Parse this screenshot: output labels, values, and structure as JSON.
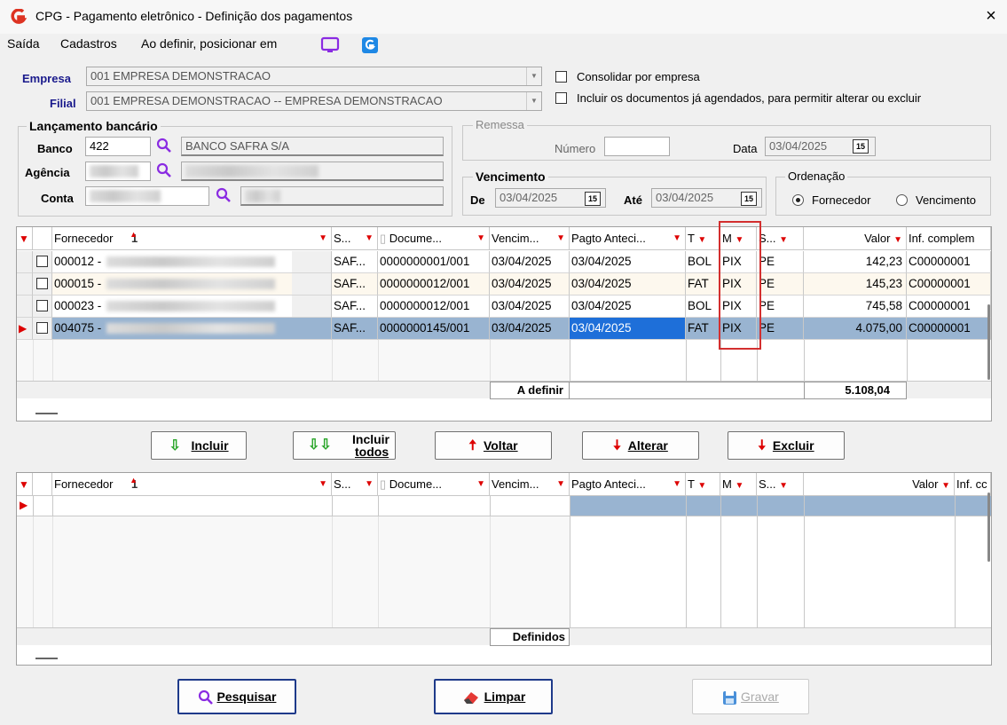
{
  "window": {
    "title": "CPG - Pagamento eletrônico - Definição dos pagamentos",
    "close": "×"
  },
  "menu": {
    "saida": "Saída",
    "cadastros": "Cadastros",
    "ao_definir": "Ao definir, posicionar em"
  },
  "empresa": {
    "label": "Empresa",
    "value": "001 EMPRESA DEMONSTRACAO"
  },
  "filial": {
    "label": "Filial",
    "value": "001 EMPRESA DEMONSTRACAO -- EMPRESA DEMONSTRACAO"
  },
  "options": {
    "consolidar": "Consolidar por empresa",
    "incluir_agendados": "Incluir os documentos já agendados, para permitir alterar ou excluir"
  },
  "lancamento": {
    "title": "Lançamento bancário",
    "banco_label": "Banco",
    "banco_value": "422",
    "banco_name": "BANCO SAFRA S/A",
    "agencia_label": "Agência",
    "conta_label": "Conta"
  },
  "remessa": {
    "title": "Remessa",
    "numero_label": "Número",
    "numero_value": "",
    "data_label": "Data",
    "data_value": "03/04/2025"
  },
  "vencimento": {
    "title": "Vencimento",
    "de_label": "De",
    "de_value": "03/04/2025",
    "ate_label": "Até",
    "ate_value": "03/04/2025"
  },
  "ordenacao": {
    "title": "Ordenação",
    "fornecedor": "Fornecedor",
    "vencimento": "Vencimento",
    "selected": "Fornecedor"
  },
  "cal_icon": "15",
  "grid_headers": {
    "fornecedor": "Fornecedor",
    "sort_num": "1",
    "s": "S...",
    "documento": "Docume...",
    "vencimento": "Vencim...",
    "pagto": "Pagto Anteci...",
    "t": "T",
    "m": "M",
    "s2": "S...",
    "valor": "Valor",
    "inf": "Inf. complem"
  },
  "grid2_headers": {
    "inf": "Inf. cc"
  },
  "top_rows": [
    {
      "fornecedor": "000012 -",
      "s": "SAF...",
      "documento": "0000000001/001",
      "vencimento": "03/04/2025",
      "pagto": "03/04/2025",
      "t": "BOL",
      "m": "PIX",
      "s2": "PE",
      "valor": "142,23",
      "inf": "C00000001"
    },
    {
      "fornecedor": "000015 -",
      "s": "SAF...",
      "documento": "0000000012/001",
      "vencimento": "03/04/2025",
      "pagto": "03/04/2025",
      "t": "FAT",
      "m": "PIX",
      "s2": "PE",
      "valor": "145,23",
      "inf": "C00000001"
    },
    {
      "fornecedor": "000023 -",
      "s": "SAF...",
      "documento": "0000000012/001",
      "vencimento": "03/04/2025",
      "pagto": "03/04/2025",
      "t": "BOL",
      "m": "PIX",
      "s2": "PE",
      "valor": "745,58",
      "inf": "C00000001"
    },
    {
      "fornecedor": "004075 -",
      "s": "SAF...",
      "documento": "0000000145/001",
      "vencimento": "03/04/2025",
      "pagto": "03/04/2025",
      "t": "FAT",
      "m": "PIX",
      "s2": "PE",
      "valor": "4.075,00",
      "inf": "C00000001"
    }
  ],
  "totals_top": {
    "label": "A definir",
    "value": "5.108,04"
  },
  "totals_bottom": {
    "label": "Definidos"
  },
  "actions": {
    "incluir": "Incluir",
    "incluir_todos_1": "Incluir",
    "incluir_todos_2": "todos",
    "voltar": "Voltar",
    "alterar": "Alterar",
    "excluir": "Excluir"
  },
  "footer": {
    "pesquisar": "Pesquisar",
    "limpar": "Limpar",
    "gravar": "Gravar"
  },
  "colors": {
    "selected_row": "#99b4d1",
    "selected_cell": "#1e6fd9",
    "highlight_border": "#d32f2f",
    "filter_red": "#dd0000"
  }
}
